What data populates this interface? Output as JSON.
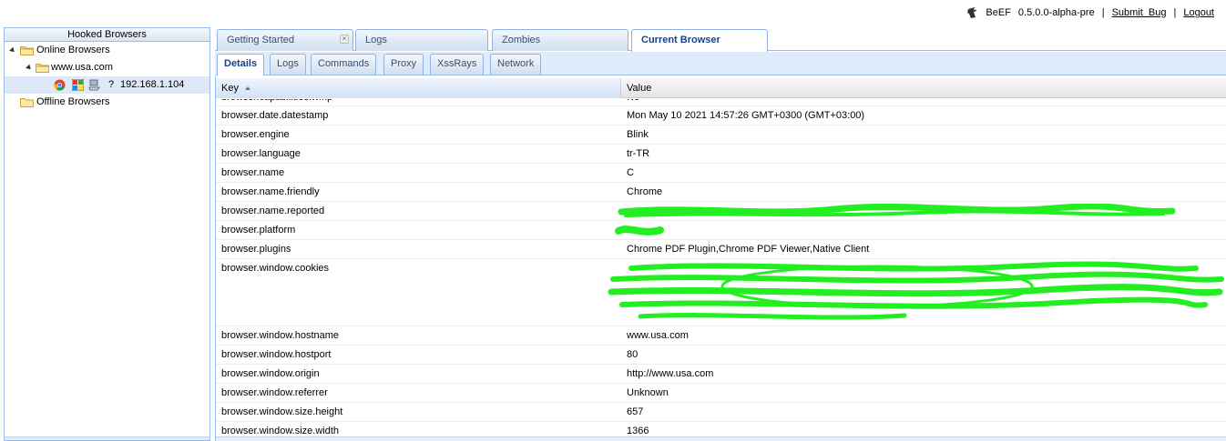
{
  "header": {
    "app_name": "BeEF",
    "version": "0.5.0.0-alpha-pre",
    "separator": "|",
    "submit_bug": "Submit  Bug",
    "logout": "Logout"
  },
  "left_panel": {
    "title": "Hooked Browsers",
    "online_label": "Online Browsers",
    "domain_label": "www.usa.com",
    "host_label": "192.168.1.104",
    "offline_label": "Offline Browsers",
    "unknown_glyph": "?"
  },
  "main_tabs": [
    {
      "label": "Getting Started"
    },
    {
      "label": "Logs"
    },
    {
      "label": "Zombies"
    },
    {
      "label": "Current Browser"
    }
  ],
  "sub_tabs": [
    {
      "label": "Details"
    },
    {
      "label": "Logs"
    },
    {
      "label": "Commands"
    },
    {
      "label": "Proxy"
    },
    {
      "label": "XssRays"
    },
    {
      "label": "Network"
    }
  ],
  "grid": {
    "col_key": "Key",
    "col_value": "Value",
    "rows": [
      {
        "key": "browser.capabilities.wmp",
        "value": "No"
      },
      {
        "key": "browser.date.datestamp",
        "value": "Mon May 10 2021 14:57:26 GMT+0300 (GMT+03:00)"
      },
      {
        "key": "browser.engine",
        "value": "Blink"
      },
      {
        "key": "browser.language",
        "value": "tr-TR"
      },
      {
        "key": "browser.name",
        "value": "C"
      },
      {
        "key": "browser.name.friendly",
        "value": "Chrome"
      },
      {
        "key": "browser.name.reported",
        "value": ""
      },
      {
        "key": "browser.platform",
        "value": ""
      },
      {
        "key": "browser.plugins",
        "value": "Chrome PDF Plugin,Chrome PDF Viewer,Native Client"
      },
      {
        "key": "browser.window.cookies",
        "value": ""
      },
      {
        "key": "browser.window.hostname",
        "value": "www.usa.com"
      },
      {
        "key": "browser.window.hostport",
        "value": "80"
      },
      {
        "key": "browser.window.origin",
        "value": "http://www.usa.com"
      },
      {
        "key": "browser.window.referrer",
        "value": "Unknown"
      },
      {
        "key": "browser.window.size.height",
        "value": "657"
      },
      {
        "key": "browser.window.size.width",
        "value": "1366"
      }
    ]
  },
  "colors": {
    "redaction": "#22ee22",
    "border": "#99bbe8",
    "selected": "#dfe8f6"
  }
}
